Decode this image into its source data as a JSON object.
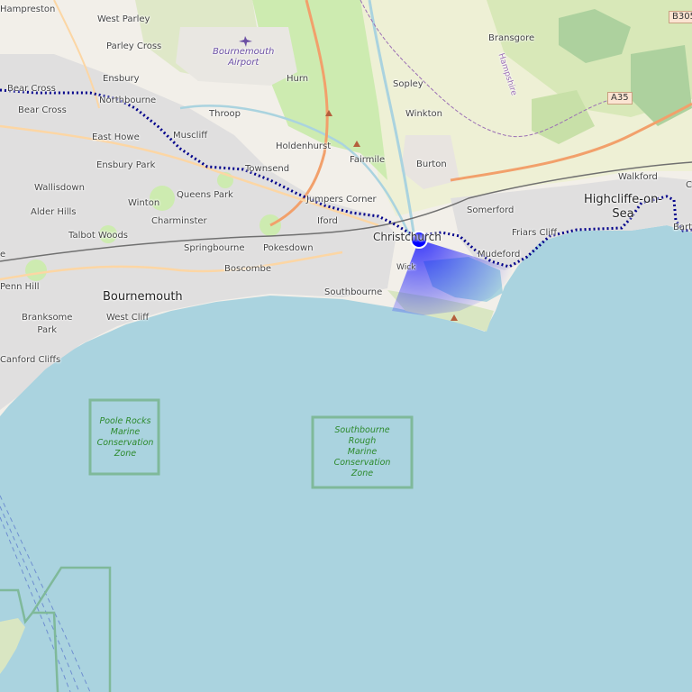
{
  "map": {
    "center_marker": {
      "name": "Christchurch"
    },
    "places": {
      "hampreston": "Hampreston",
      "west_parley": "West Parley",
      "parley_cross": "Parley Cross",
      "ensbury": "Ensbury",
      "bear_cross_edge": "Bear Cross",
      "bear_cross": "Bear Cross",
      "northbourne": "Northbourne",
      "east_howe": "East Howe",
      "muscliff": "Muscliff",
      "throop": "Throop",
      "hurn": "Hurn",
      "holdenhurst": "Holdenhurst",
      "sopley": "Sopley",
      "winkton": "Winkton",
      "bransgore": "Bransgore",
      "ensbury_park": "Ensbury Park",
      "townsend": "Townsend",
      "fairmile": "Fairmile",
      "burton": "Burton",
      "walkford": "Walkford",
      "wallisdown": "Wallisdown",
      "queens_park": "Queens Park",
      "winton": "Winton",
      "jumpers_corner": "Jumpers Corner",
      "highcliffe": "Highcliffe-on-\nSea",
      "somerford": "Somerford",
      "alder_hills": "Alder Hills",
      "charminster": "Charminster",
      "iford": "Iford",
      "christchurch": "Christchurch",
      "talbot_woods": "Talbot Woods",
      "springbourne": "Springbourne",
      "pokesdown": "Pokesdown",
      "friars_cliff": "Friars Cliff",
      "mudeford": "Mudeford",
      "boscombe": "Boscombe",
      "wick": "Wick",
      "penn_hill": "Penn Hill",
      "bournemouth": "Bournemouth",
      "southbourne": "Southbourne",
      "branksome_park": "Branksome\nPark",
      "west_cliff": "West Cliff",
      "canford_cliffs": "Canford Cliffs",
      "barton_edge": "Bart",
      "c_edge": "C",
      "e_edge": "e"
    },
    "airport": "Bournemouth\nAirport",
    "county": "Hampshire",
    "roads": {
      "a35": "A35",
      "b3055": "B305"
    },
    "zones": {
      "poole_rocks": "Poole Rocks\nMarine\nConservation\nZone",
      "southbourne_rough": "Southbourne\nRough\nMarine\nConservation\nZone"
    },
    "colors": {
      "sea": "#aad3df",
      "land": "#f2efe9",
      "urban": "#e0dfdf",
      "green": "#cdebb0",
      "route": "#00008b",
      "marker": "#0000ff",
      "zone_border": "#7fb99a"
    }
  }
}
